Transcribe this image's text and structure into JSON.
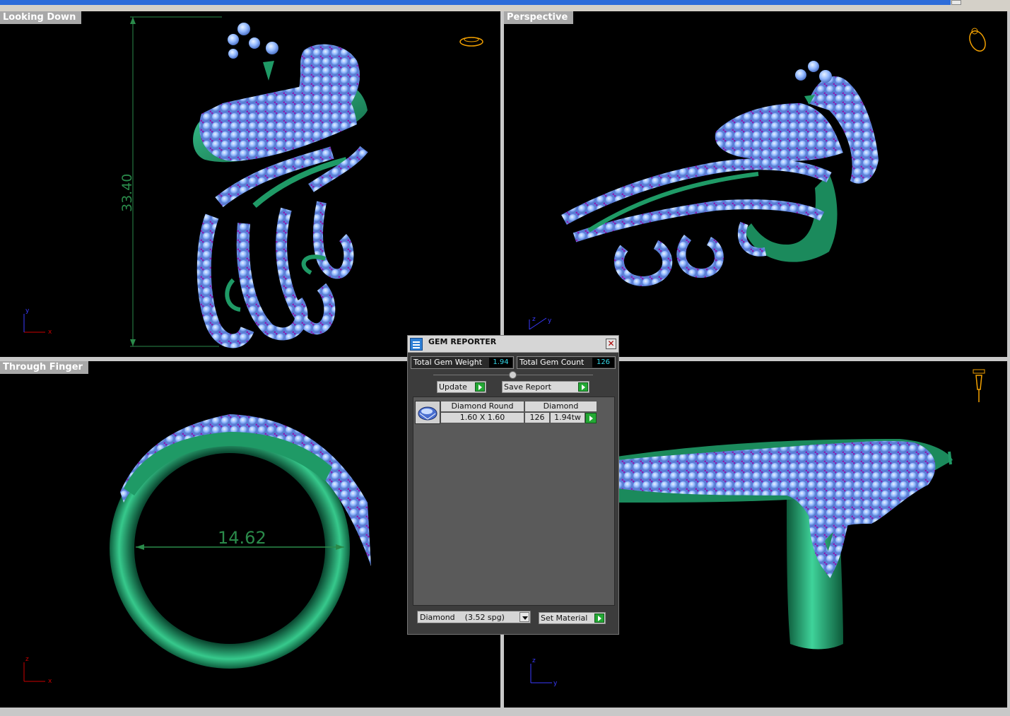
{
  "viewports": {
    "top": {
      "label": "Looking Down",
      "dimension": "33.40"
    },
    "perspective": {
      "label": "Perspective"
    },
    "front": {
      "label": "Through Finger",
      "dimension": "14.62"
    },
    "right": {
      "label": ""
    }
  },
  "axes": {
    "x": "x",
    "y": "y",
    "z": "z"
  },
  "gem_reporter": {
    "title": "GEM REPORTER",
    "close_icon": "close-icon",
    "total_weight_label": "Total Gem Weight",
    "total_weight_value": "1.94",
    "total_count_label": "Total Gem Count",
    "total_count_value": "126",
    "update_label": "Update",
    "save_report_label": "Save Report",
    "gems": [
      {
        "name": "Diamond Round",
        "size": "1.60 X 1.60",
        "material": "Diamond",
        "count": "126",
        "weight": "1.94tw"
      }
    ],
    "material_select": "Diamond    (3.52 spg)",
    "set_material_label": "Set Material"
  },
  "colors": {
    "metal": "#1f8a5c",
    "gem": "#8fb8ff",
    "prong": "#8a1fb0",
    "dimension": "#2a8a4a",
    "viewport_bg": "#000000"
  }
}
